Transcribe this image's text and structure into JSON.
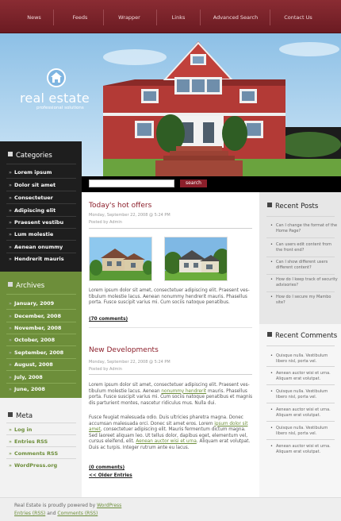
{
  "nav": {
    "items": [
      {
        "label": "News"
      },
      {
        "label": "Feeds"
      },
      {
        "label": "Wrapper"
      },
      {
        "label": "Links"
      },
      {
        "label": "Advanced Search"
      },
      {
        "label": "Contact Us"
      }
    ]
  },
  "header": {
    "logo_title": "real estate",
    "logo_subtitle": "professional solutions"
  },
  "search": {
    "value": "",
    "button_label": "search"
  },
  "categories": {
    "title": "Categories",
    "items": [
      "Lorem ipsum",
      "Dolor sit amet",
      "Consectetuer",
      "Adipiscing elit",
      "Praesent vestibu",
      "Lum molestie",
      "Aenean onummy",
      "Hendrerit mauris"
    ]
  },
  "archives": {
    "title": "Archives",
    "items": [
      "January, 2009",
      "December, 2008",
      "November, 2008",
      "October, 2008",
      "September, 2008",
      "August, 2008",
      "July, 2008",
      "June, 2008"
    ]
  },
  "meta": {
    "title": "Meta",
    "items": [
      "Log in",
      "Entries RSS",
      "Comments RSS",
      "WordPress.org"
    ]
  },
  "posts": [
    {
      "title": "Today's hot offers",
      "date": "Monday, September 22, 2008 @ 5:24 PM",
      "author": "Posted by Admin",
      "body": "Lorem ipsum dolor sit amet, consectetuer adipiscing elit. Praesent ves-tibulum molestie lacus. Aenean nonummy hendrerit mauris. Phasellus porta. Fusce suscipit varius mi. Cum sociis natoque penatibus.",
      "comments": "(70 comments)"
    },
    {
      "title": "New Developments",
      "date": "Monday, September 22, 2008 @ 5:24 PM",
      "author": "Posted by Admin",
      "p1_a": "Lorem ipsum dolor sit amet, consectetuer adipiscing elit. Praesent ves-tibulum molestie lacus. Aenean ",
      "p1_link": "nonummy hendrerit",
      "p1_b": " mauris. Phasellus porta. Fusce suscipit varius mi. Cum sociis natoque penatibus et magnis dis parturient montes, nascetur ridiculus mus. Nulla dui.",
      "p2_a": "Fusce feugiat malesuada odio. Duis ultricies pharetra magna. Donec accumsan malesuada orci. Donec sit amet eros. Lorem ",
      "p2_link1": "ipsum dolor sit amet",
      "p2_b": ", consectetuer adipiscing elit. Mauris fermentum dictum magna. Sed laoreet aliquam leo. Ut tellus dolor, dapibus eget, elementum vel, cursus eleifend, elit. ",
      "p2_link2": "Aenean auctor wisi et urna",
      "p2_c": ". Aliquam erat volutpat. Duis ac turpis. Integer rutrum ante eu lacus.",
      "comments": "(0 comments)",
      "older": "<< Older Entries"
    }
  ],
  "recent_posts": {
    "title": "Recent Posts",
    "items": [
      "Can I change the format of the Home Page?",
      "Can users edit content from the front end?",
      "Can I show different users different content?",
      "How do I keep track of security advisories?",
      "How do I secure my Mambo site?"
    ]
  },
  "recent_comments": {
    "title": "Recent Comments",
    "items": [
      "Quisque nulla. Vestibulum libero nisl, porta vel.",
      "Aenean auctor wisi et urna. Aliquam erat volutpat.",
      "Quisque nulla. Vestibulum libero nisl, porta vel.",
      "Aenean auctor wisi et urna. Aliquam erat volutpat.",
      "Quisque nulla. Vestibulum libero nisl, porta vel.",
      "Aenean auctor wisi et urna. Aliquam erat volutpat."
    ]
  },
  "footer": {
    "line1_text": "Real Estate is proudly powered by ",
    "line1_link": "WordPress",
    "line2_link1": "Entries (RSS)",
    "line2_and": " and ",
    "line2_link2": "Comments (RSS)"
  },
  "colors": {
    "nav_bg": "#7a2229",
    "accent_red": "#8c1f2b",
    "categories_bg": "#1e1e1e",
    "archives_bg": "#6d8e3a",
    "link_green": "#6d8e3a"
  }
}
